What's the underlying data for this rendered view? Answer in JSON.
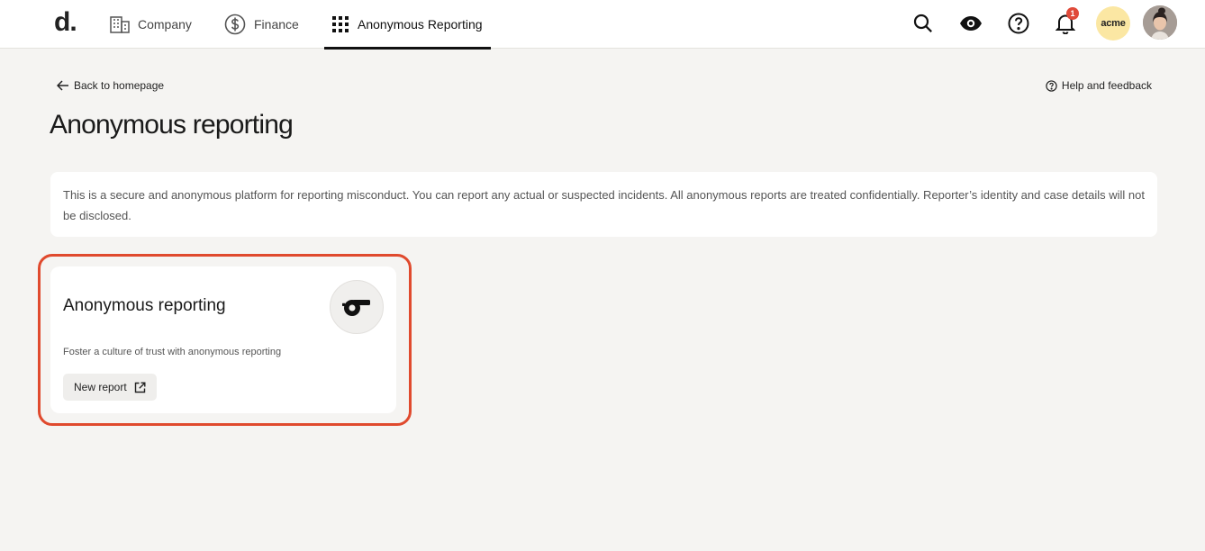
{
  "header": {
    "logo": "d.",
    "tabs": [
      {
        "label": "Company",
        "icon": "building-icon"
      },
      {
        "label": "Finance",
        "icon": "dollar-circle-icon"
      },
      {
        "label": "Anonymous Reporting",
        "icon": "apps-grid-icon",
        "active": true
      }
    ],
    "notification_count": "1",
    "company_badge": "acme"
  },
  "nav": {
    "back_label": "Back to homepage",
    "help_label": "Help and feedback"
  },
  "page": {
    "title": "Anonymous reporting",
    "intro": "This is a secure and anonymous platform for reporting misconduct. You can report any actual or suspected incidents. All anonymous reports are treated confidentially. Reporter’s identity and case details will not be disclosed."
  },
  "card": {
    "title": "Anonymous reporting",
    "description": "Foster a culture of trust with anonymous reporting",
    "button_label": "New report",
    "icon": "whistle-icon"
  },
  "colors": {
    "background": "#f5f4f2",
    "highlight": "#e04a2e",
    "badge": "#e04a3a",
    "acme": "#fbe7a3"
  }
}
